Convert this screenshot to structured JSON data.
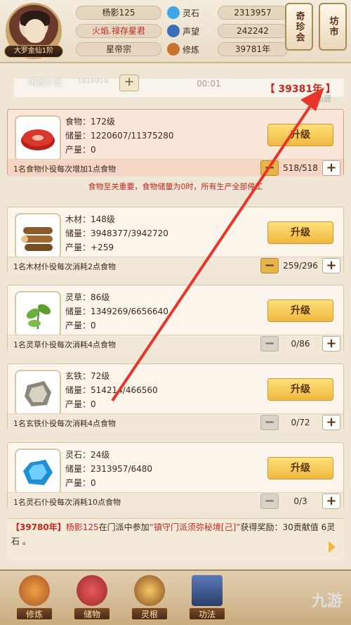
{
  "header": {
    "rank": "大罗金仙1阶",
    "player_name": "杨影125",
    "title": "火焰.禄存星君",
    "sect": "星帝宗",
    "resources": [
      {
        "name": "灵石",
        "value": "2313957",
        "icon": "spirit-stone-icon",
        "color": "#3da7e5"
      },
      {
        "name": "声望",
        "value": "242242",
        "icon": "prestige-icon",
        "color": "#3a6fb7"
      },
      {
        "name": "修炼",
        "value": "39781年",
        "icon": "cultivation-icon",
        "color": "#c9732f"
      }
    ],
    "side_buttons": [
      "奇珍会",
      "坊市"
    ]
  },
  "topbar": {
    "idle_label": "闲置仆役",
    "idle_count": "1816916",
    "timer": "00:01",
    "year": "【 39381年 】",
    "shrine_label": "仙居"
  },
  "cards": [
    {
      "name": "食物：172级",
      "storage": "储量：1220607/11375280",
      "output": "产量：0",
      "upgrade": "升级",
      "footer": "1名食物仆役每次增加1点食物",
      "count": "518/518",
      "icon": "meat-icon"
    },
    {
      "name": "木材：148级",
      "storage": "储量：3948377/3942720",
      "output": "产量：+259",
      "upgrade": "升级",
      "footer": "1名木材仆役每次消耗2点食物",
      "count": "259/296",
      "icon": "wood-icon"
    },
    {
      "name": "灵草：86级",
      "storage": "储量：1349269/6656640",
      "output": "产量：0",
      "upgrade": "升级",
      "footer": "1名灵草仆役每次消耗4点食物",
      "count": "0/86",
      "icon": "herb-icon"
    },
    {
      "name": "玄铁：72级",
      "storage": "储量：514214/466560",
      "output": "产量：0",
      "upgrade": "升级",
      "footer": "1名玄铁仆役每次消耗4点食物",
      "count": "0/72",
      "icon": "iron-icon"
    },
    {
      "name": "灵石：24级",
      "storage": "储量：2313957/6480",
      "output": "产量：0",
      "upgrade": "升级",
      "footer": "1名灵石仆役每次消耗10点食物",
      "count": "0/3",
      "icon": "crystal-icon"
    }
  ],
  "warning": "食物至关重要，食物储量为0时，所有生产全部停工",
  "log": {
    "year": "【39780年】",
    "name": "杨影125",
    "text1": "在门派中参加",
    "event": "“镇守门派须弥秘境[己]”",
    "text2": "获得奖励：30贡献值 6灵石 。"
  },
  "nav": [
    {
      "label": "修炼",
      "icon": "cultivation-nav-icon"
    },
    {
      "label": "储物",
      "icon": "storage-bag-icon"
    },
    {
      "label": "灵根",
      "icon": "spirit-root-icon"
    },
    {
      "label": "功法",
      "icon": "technique-book-icon"
    }
  ],
  "watermark": "九游"
}
